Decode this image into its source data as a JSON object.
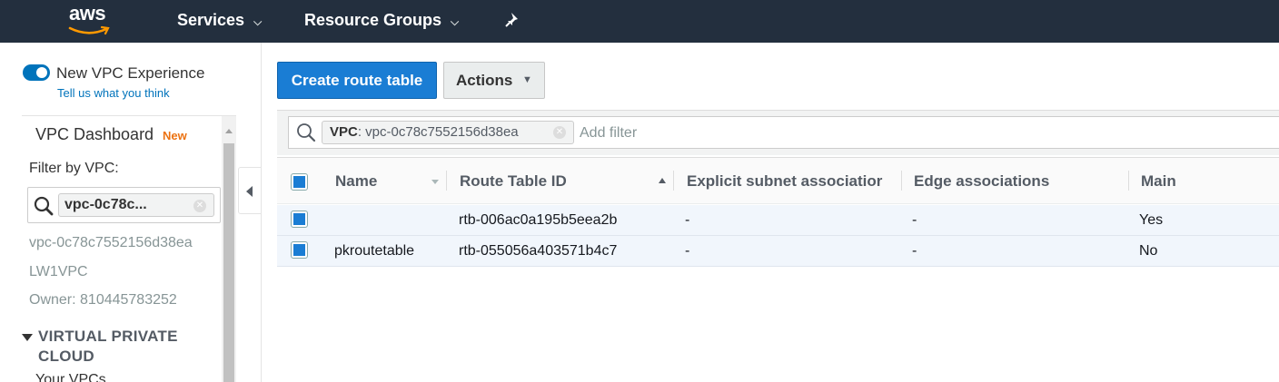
{
  "topbar": {
    "logo_text": "aws",
    "nav": [
      {
        "label": "Services"
      },
      {
        "label": "Resource Groups"
      }
    ]
  },
  "sidebar": {
    "toggle_label": "New VPC Experience",
    "feedback_link": "Tell us what you think",
    "dashboard_label": "VPC Dashboard",
    "dashboard_badge": "New",
    "filter_label": "Filter by VPC:",
    "filter_token": "vpc-0c78c...",
    "vpc_id": "vpc-0c78c7552156d38ea",
    "vpc_name": "LW1VPC",
    "owner": "Owner: 810445783252",
    "section_title_line1": "VIRTUAL PRIVATE",
    "section_title_line2": "CLOUD",
    "sub_item": "Your VPCs"
  },
  "toolbar": {
    "create_label": "Create route table",
    "actions_label": "Actions"
  },
  "filter": {
    "chip_key": "VPC",
    "chip_value": ": vpc-0c78c7552156d38ea",
    "placeholder": "Add filter"
  },
  "table": {
    "headers": [
      "Name",
      "Route Table ID",
      "Explicit subnet associatior",
      "Edge associations",
      "Main"
    ],
    "rows": [
      {
        "name": "",
        "id": "rtb-006ac0a195b5eea2b",
        "explicit": "-",
        "edge": "-",
        "main": "Yes"
      },
      {
        "name": "pkroutetable",
        "id": "rtb-055056a403571b4c7",
        "explicit": "-",
        "edge": "-",
        "main": "No"
      }
    ]
  },
  "colors": {
    "topbar": "#232f3e",
    "primary": "#1a7dd4",
    "accent_new": "#ec7211",
    "selected_row": "#f1f6fc"
  },
  "icons": [
    "aws-smile-icon",
    "chevron-down-icon",
    "pin-icon",
    "search-icon",
    "clear-icon",
    "collapse-left-icon",
    "sort-icon"
  ]
}
